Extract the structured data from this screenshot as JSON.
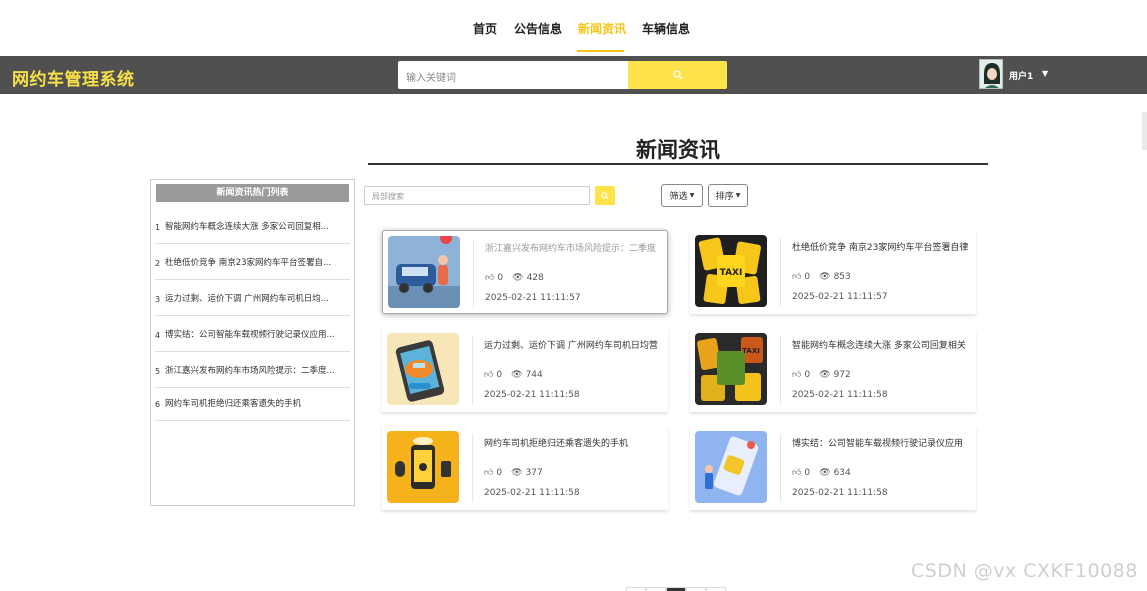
{
  "top_nav": {
    "items": [
      {
        "label": "首页"
      },
      {
        "label": "公告信息"
      },
      {
        "label": "新闻资讯"
      },
      {
        "label": "车辆信息"
      }
    ],
    "active_index": 2
  },
  "header": {
    "logo_text": "网约车管理系统",
    "search_placeholder": "输入关键词",
    "username": "用户1"
  },
  "main": {
    "page_title": "新闻资讯",
    "local_search_placeholder": "局部搜索",
    "filter_label": "筛选",
    "sort_label": "排序"
  },
  "sidebar": {
    "title": "新闻资讯热门列表",
    "items": [
      {
        "num": "1",
        "text": "智能网约车概念连续大涨 多家公司回复相..."
      },
      {
        "num": "2",
        "text": "杜绝低价竞争 南京23家网约车平台签署自..."
      },
      {
        "num": "3",
        "text": "运力过剩、运价下调 广州网约车司机日均..."
      },
      {
        "num": "4",
        "text": "博实结：公司智能车载视频行驶记录仪应用..."
      },
      {
        "num": "5",
        "text": "浙江嘉兴发布网约车市场风险提示：二季度..."
      },
      {
        "num": "6",
        "text": "网约车司机拒绝归还乘客遗失的手机"
      }
    ]
  },
  "news_cards": [
    {
      "title": "浙江嘉兴发布网约车市场风险提示：二季度",
      "likes": "0",
      "views": "428",
      "date": "2025-02-21 11:11:57"
    },
    {
      "title": "杜绝低价竞争 南京23家网约车平台签署自律",
      "likes": "0",
      "views": "853",
      "date": "2025-02-21 11:11:57"
    },
    {
      "title": "运力过剩、运价下调 广州网约车司机日均营",
      "likes": "0",
      "views": "744",
      "date": "2025-02-21 11:11:58"
    },
    {
      "title": "智能网约车概念连续大涨 多家公司回复相关",
      "likes": "0",
      "views": "972",
      "date": "2025-02-21 11:11:58"
    },
    {
      "title": "网约车司机拒绝归还乘客遗失的手机",
      "likes": "0",
      "views": "377",
      "date": "2025-02-21 11:11:58"
    },
    {
      "title": "博实结：公司智能车载视频行驶记录仪应用",
      "likes": "0",
      "views": "634",
      "date": "2025-02-21 11:11:58"
    }
  ],
  "watermark": "CSDN @vx CXKF10088",
  "colors": {
    "accent": "#ffe34a",
    "header_bg": "#505050",
    "logo": "#f8e04a",
    "active_nav": "#f5c518"
  }
}
